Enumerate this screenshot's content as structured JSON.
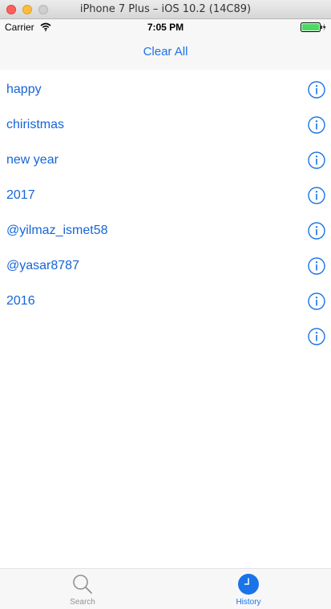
{
  "window": {
    "title": "iPhone 7 Plus – iOS 10.2 (14C89)"
  },
  "status_bar": {
    "carrier": "Carrier",
    "time": "7:05 PM"
  },
  "nav": {
    "clear_all_label": "Clear All"
  },
  "history": {
    "items": [
      {
        "label": "happy"
      },
      {
        "label": "chiristmas"
      },
      {
        "label": "new year"
      },
      {
        "label": "2017"
      },
      {
        "label": "@yilmaz_ismet58"
      },
      {
        "label": "@yasar8787"
      },
      {
        "label": "2016"
      },
      {
        "label": ""
      }
    ]
  },
  "tab_bar": {
    "tabs": [
      {
        "label": "Search",
        "icon": "magnifier-icon",
        "selected": false
      },
      {
        "label": "History",
        "icon": "clock-icon",
        "selected": true
      }
    ]
  },
  "colors": {
    "accent": "#1a73e8",
    "text_link": "#1565d8",
    "battery": "#4cd964"
  }
}
